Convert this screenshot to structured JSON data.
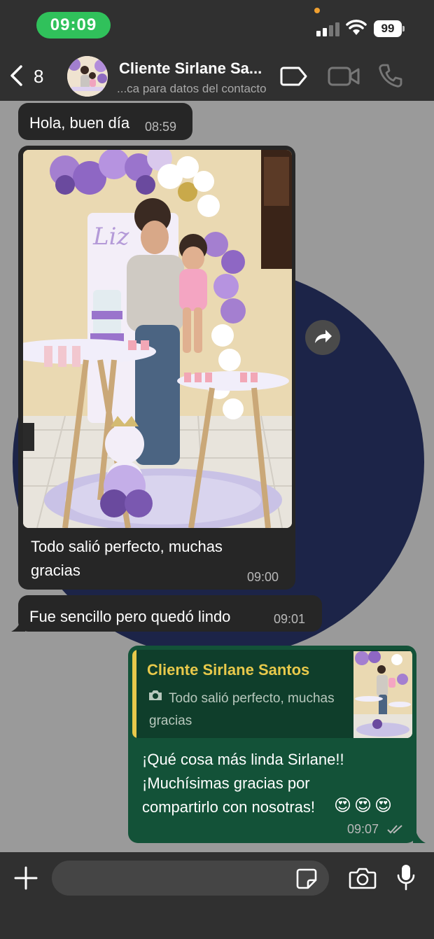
{
  "status_bar": {
    "time": "09:09",
    "battery": "99"
  },
  "header": {
    "back_count": "8",
    "contact_name": "Cliente Sirlane Sa...",
    "contact_subtitle": "...ca para datos del contacto"
  },
  "messages": [
    {
      "direction": "in",
      "text": "Hola, buen día",
      "time": "08:59"
    },
    {
      "direction": "in",
      "has_photo": true,
      "text_line1": "Todo salió perfecto, muchas",
      "text_line2": "gracias",
      "time": "09:00"
    },
    {
      "direction": "in",
      "text": "Fue sencillo pero quedó lindo",
      "time": "09:01"
    },
    {
      "direction": "out",
      "quote_name": "Cliente Sirlane Santos",
      "quote_text": "Todo salió perfecto, muchas gracias",
      "text_line1": "¡Qué cosa más linda Sirlane!!",
      "text_line2": "¡Muchísimas gracias por",
      "text_line3": "compartirlo con nosotras!",
      "emojis": "😍😍😍",
      "time": "09:07",
      "status": "read"
    }
  ],
  "input": {
    "placeholder": ""
  },
  "colors": {
    "bar_bg": "#303030",
    "incoming_bubble": "#262626",
    "outgoing_bubble": "#135238",
    "quote_accent": "#e8c94b",
    "time_pill": "#30c15b"
  }
}
